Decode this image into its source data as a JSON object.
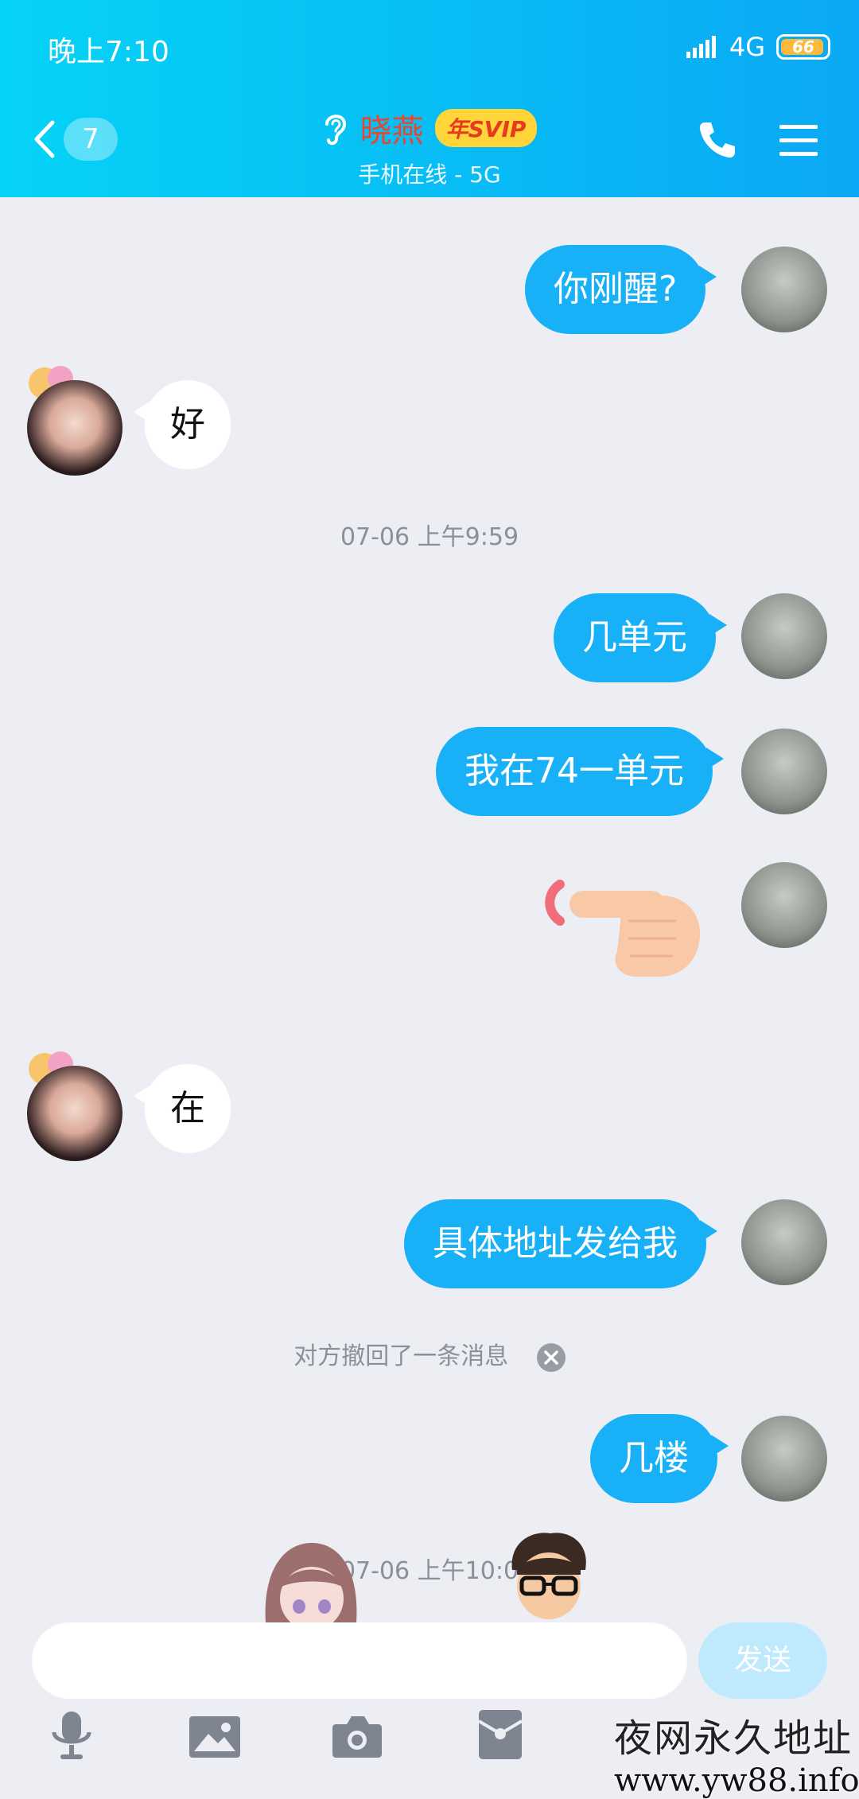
{
  "status_bar": {
    "time": "晚上7:10",
    "network": "4G",
    "battery": "66"
  },
  "header": {
    "back_count": "7",
    "contact_name": "晓燕",
    "badge": "年SVIP",
    "status": "手机在线 - 5G"
  },
  "messages": [
    {
      "text": "你刚醒?"
    },
    {
      "text": "好"
    },
    {
      "text": "几单元"
    },
    {
      "text": "我在74一单元"
    },
    {
      "text": "在"
    },
    {
      "text": "具体地址发给我"
    },
    {
      "text": "几楼"
    }
  ],
  "timestamps": [
    "07-06 上午9:59",
    "07-06 上午10:0"
  ],
  "recall_notice": "对方撤回了一条消息",
  "composer": {
    "send_label": "发送"
  },
  "watermark": {
    "line1": "夜网永久地址",
    "line2": "www.yw88.info"
  },
  "colors": {
    "header_start": "#05d3f6",
    "header_end": "#0aa8f4",
    "bubble_out": "#18b1f7",
    "badge": "#ffd53a"
  }
}
